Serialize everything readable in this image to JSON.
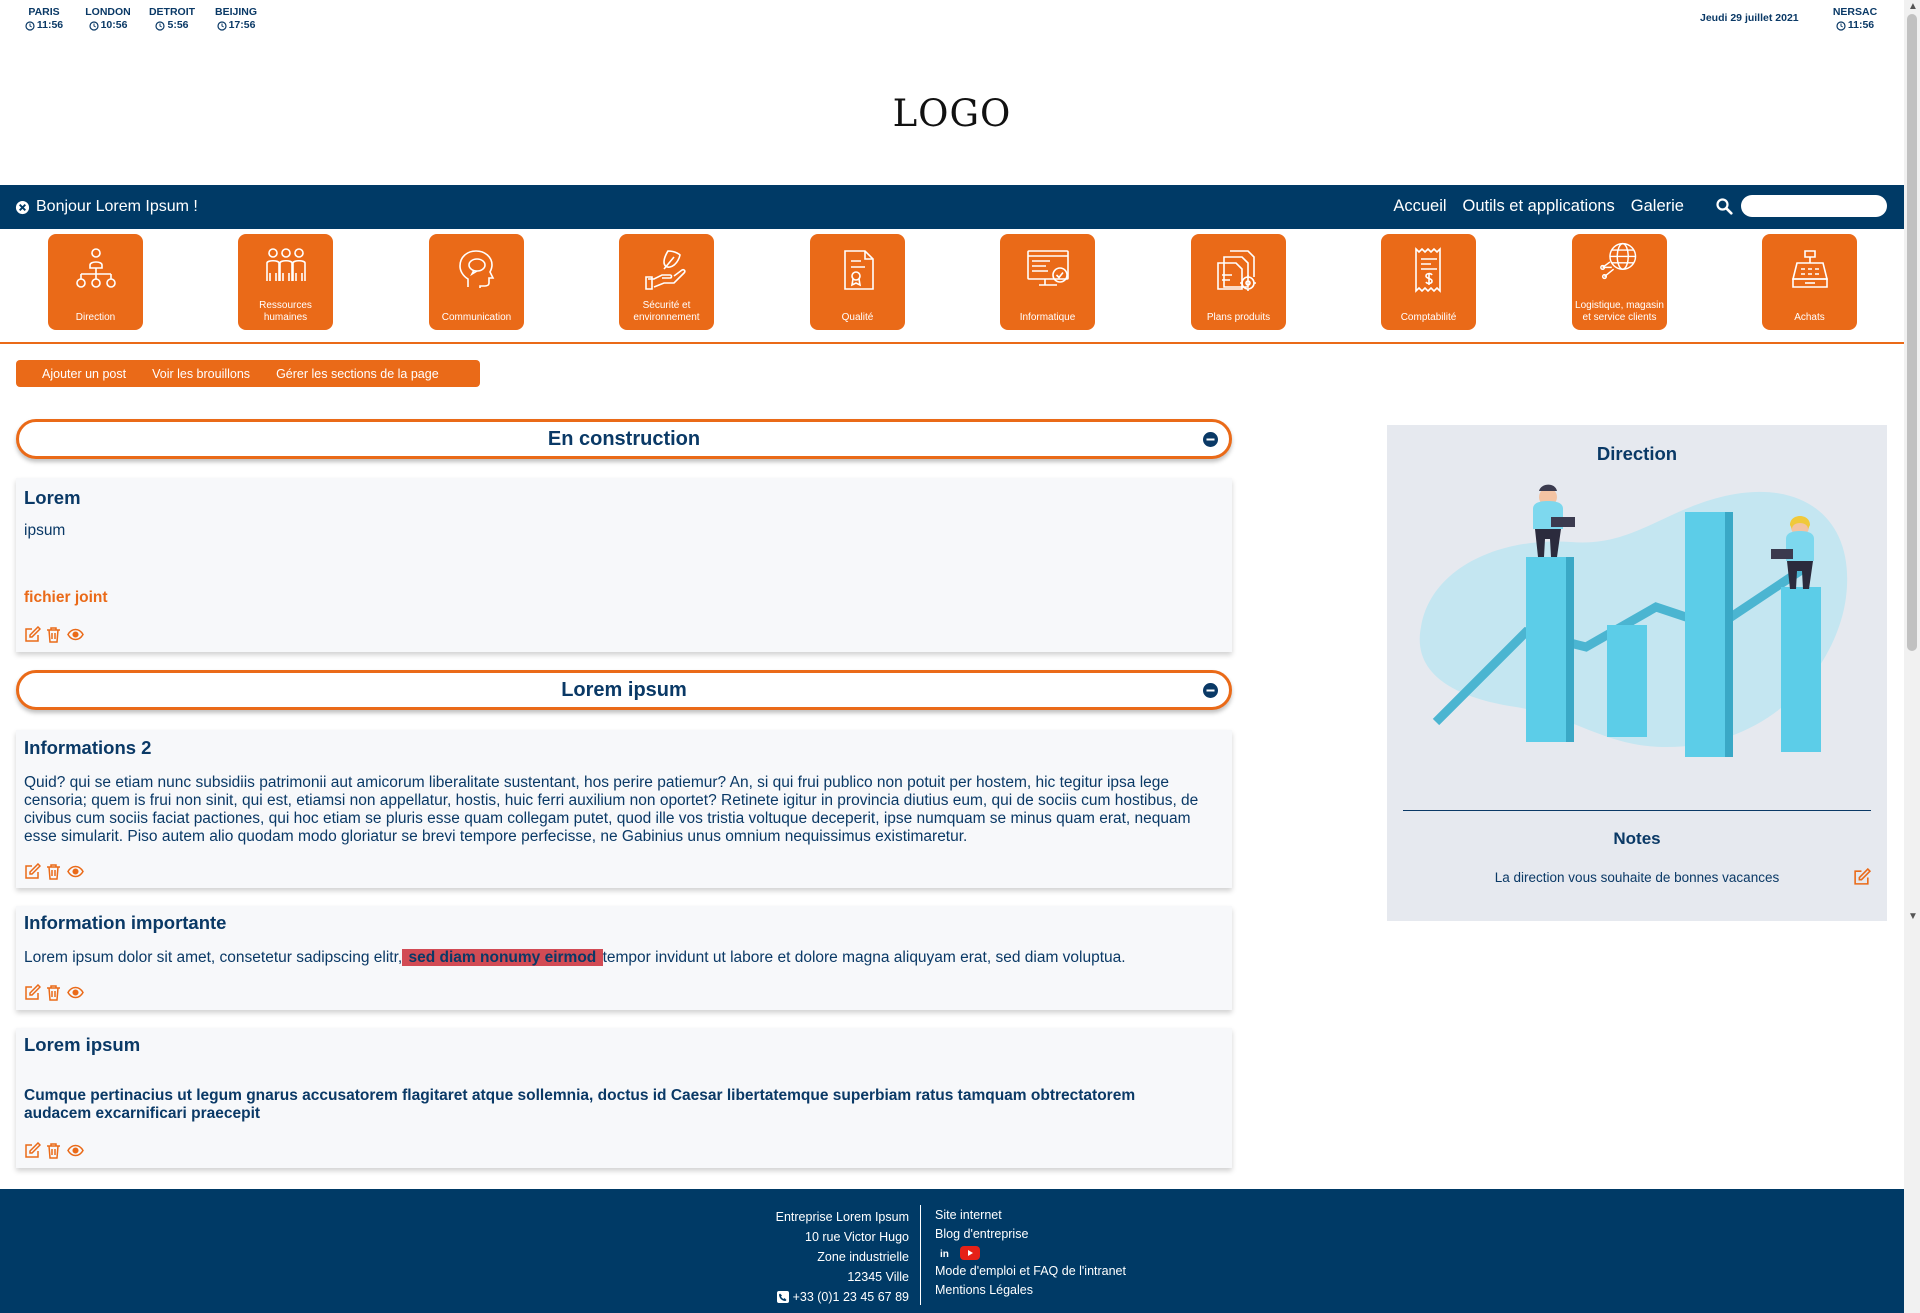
{
  "clocks": [
    {
      "city": "PARIS",
      "time": "11:56"
    },
    {
      "city": "LONDON",
      "time": "10:56"
    },
    {
      "city": "DETROIT",
      "time": "5:56"
    },
    {
      "city": "BEIJING",
      "time": "17:56"
    }
  ],
  "date": "Jeudi 29 juillet 2021",
  "local_clock": {
    "city": "NERSAC",
    "time": "11:56"
  },
  "logo": "LOGO",
  "nav": {
    "greeting": "Bonjour Lorem Ipsum !",
    "links": [
      "Accueil",
      "Outils et applications",
      "Galerie"
    ]
  },
  "tiles": [
    {
      "label": "Direction",
      "icon": "org-chart-icon"
    },
    {
      "label": "Ressources humaines",
      "icon": "people-icon"
    },
    {
      "label": "Communication",
      "icon": "head-speech-icon"
    },
    {
      "label": "Sécurité et environnement",
      "icon": "hand-leaf-icon"
    },
    {
      "label": "Qualité",
      "icon": "certificate-icon"
    },
    {
      "label": "Informatique",
      "icon": "computer-check-icon"
    },
    {
      "label": "Plans produits",
      "icon": "blueprint-gear-icon"
    },
    {
      "label": "Comptabilité",
      "icon": "receipt-icon"
    },
    {
      "label": "Logistique, magasin et service clients",
      "icon": "globe-network-icon"
    },
    {
      "label": "Achats",
      "icon": "cash-register-icon"
    }
  ],
  "actions": [
    "Ajouter un post",
    "Voir les brouillons",
    "Gérer les sections de la page"
  ],
  "sections": {
    "s1_title": "En construction",
    "s2_title": "Lorem ipsum"
  },
  "posts": {
    "p1": {
      "title": "Lorem",
      "body": "ipsum",
      "attachment": "fichier joint"
    },
    "p2": {
      "title": "Informations 2",
      "body": "Quid? qui se etiam nunc subsidiis patrimonii aut amicorum liberalitate sustentant, hos perire patiemur? An, si qui frui publico non potuit per hostem, hic tegitur ipsa lege censoria; quem is frui non sinit, qui est, etiamsi non appellatur, hostis, huic ferri auxilium non oportet? Retinete igitur in provincia diutius eum, qui de sociis cum hostibus, de civibus cum sociis faciat pactiones, qui hoc etiam se pluris esse quam collegam putet, quod ille vos tristia voltuque deceperit, ipse numquam se minus quam erat, nequam esse simularit. Piso autem alio quodam modo gloriatur se brevi tempore perfecisse, ne Gabinius unus omnium nequissimus existimaretur."
    },
    "p3": {
      "title": "Information importante",
      "body_before": "Lorem ipsum dolor sit amet, consetetur sadipscing elitr,",
      "body_highlight": " sed diam nonumy eirmod ",
      "body_after": "tempor invidunt ut labore et dolore magna aliquyam erat, sed diam voluptua."
    },
    "p4": {
      "title": "Lorem ipsum",
      "body": "Cumque pertinacius ut legum gnarus accusatorem flagitaret atque sollemnia, doctus id Caesar libertatemque superbiam ratus tamquam obtrectatorem audacem excarnificari praecepit"
    }
  },
  "panel": {
    "title": "Direction",
    "notes_title": "Notes",
    "notes_text": "La direction vous souhaite de bonnes vacances"
  },
  "footer": {
    "company": "Entreprise Lorem Ipsum",
    "address1": "10 rue Victor Hugo",
    "address2": "Zone industrielle",
    "address3": "12345 Ville",
    "phone": "+33 (0)1 23 45 67 89",
    "links": [
      "Site internet",
      "Blog d'entreprise"
    ],
    "links2": [
      "Mode d'emploi et FAQ de l'intranet",
      "Mentions Légales"
    ],
    "social": [
      "in"
    ]
  },
  "colors": {
    "navy": "#003a66",
    "orange": "#ea6a18",
    "highlight": "#d24b54"
  }
}
